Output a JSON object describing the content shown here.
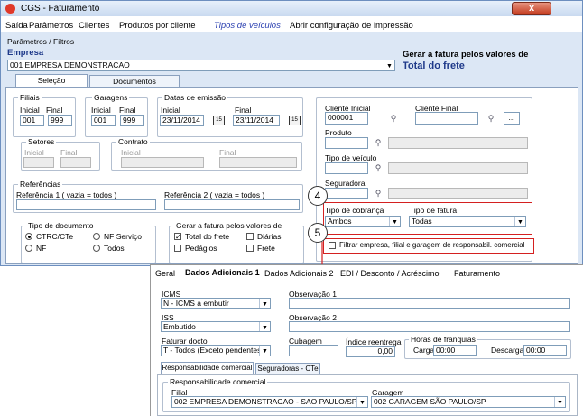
{
  "window": {
    "title": "CGS - Faturamento",
    "close": "x"
  },
  "menu": [
    "Saída",
    "Parâmetros",
    "Clientes",
    "Produtos por cliente",
    "Tipos de veículos",
    "Abrir configuração de impressão"
  ],
  "params": {
    "label": "Parâmetros / Filtros",
    "empresa_label": "Empresa",
    "empresa_value": "001 EMPRESA DEMONSTRACAO",
    "faturar_label": "Gerar a fatura pelos valores de",
    "faturar_value": "Total do frete"
  },
  "tabs": [
    "Seleção",
    "Documentos"
  ],
  "filiais": {
    "label": "Filiais",
    "inicial_label": "Inicial",
    "final_label": "Final",
    "inicial": "001",
    "final": "999"
  },
  "garagens": {
    "label": "Garagens",
    "inicial_label": "Inicial",
    "final_label": "Final",
    "inicial": "001",
    "final": "999"
  },
  "datas": {
    "label": "Datas de emissão",
    "inicial_label": "Inicial",
    "final_label": "Final",
    "inicial": "23/11/2014",
    "final": "23/11/2014",
    "cal_icon": "15"
  },
  "setores": {
    "label": "Setores",
    "inicial": "Inicial",
    "final": "Final"
  },
  "contrato": {
    "label": "Contrato",
    "inicial": "Inicial",
    "final": "Final"
  },
  "referencias": {
    "label": "Referências",
    "ref1": "Referência 1 ( vazia = todos )",
    "ref2": "Referência 2 ( vazia = todos )"
  },
  "tipo_doc": {
    "label": "Tipo de documento",
    "options": [
      "CTRC/CTe",
      "NF Serviço",
      "NF",
      "Todos"
    ]
  },
  "gerar": {
    "label": "Gerar a fatura pelos valores de",
    "options": [
      "Total do frete",
      "Diárias",
      "Pedágios",
      "Frete"
    ]
  },
  "right": {
    "cliente_ini": "Cliente Inicial",
    "cliente_fin": "Cliente Final",
    "cliente_val": "000001",
    "more": "...",
    "produto": "Produto",
    "tipo_veiculo": "Tipo de veículo",
    "seguradora": "Seguradora",
    "tipo_cobranca_label": "Tipo de cobrança",
    "tipo_cobranca": "Ambos",
    "tipo_fatura_label": "Tipo de fatura",
    "tipo_fatura": "Todas",
    "filtrar": "Filtrar empresa, filial e garagem de responsabil. comercial"
  },
  "markers": [
    "4",
    "5"
  ],
  "sub": {
    "tabs": [
      "Geral",
      "Dados Adicionais 1",
      "Dados Adicionais 2",
      "EDI / Desconto / Acréscimo",
      "Faturamento"
    ],
    "icms_label": "ICMS",
    "icms": "N - ICMS a embutir",
    "obs1": "Observação 1",
    "iss_label": "ISS",
    "iss": "Embutido",
    "obs2": "Observação 2",
    "faturar_label": "Faturar docto",
    "faturar": "T - Todos (Exceto pendentes)",
    "cubagem": "Cubagem",
    "indice_label": "Índice reentrega",
    "indice": "0,00",
    "horas_label": "Horas de franquias",
    "carga_label": "Carga",
    "carga": "00:00",
    "descarga_label": "Descarga",
    "descarga": "00:00",
    "subtabs": [
      "Responsabilidade comercial",
      "Seguradoras - CTe"
    ],
    "resp_label": "Responsabilidade comercial",
    "filial_label": "Filial",
    "filial": "002 EMPRESA DEMONSTRACAO - SAO PAULO/SP",
    "garagem_label": "Garagem",
    "garagem": "002 GARAGEM SÃO PAULO/SP"
  },
  "colors": {
    "accent": "#1f3a8a",
    "marker_red": "#d42020"
  }
}
